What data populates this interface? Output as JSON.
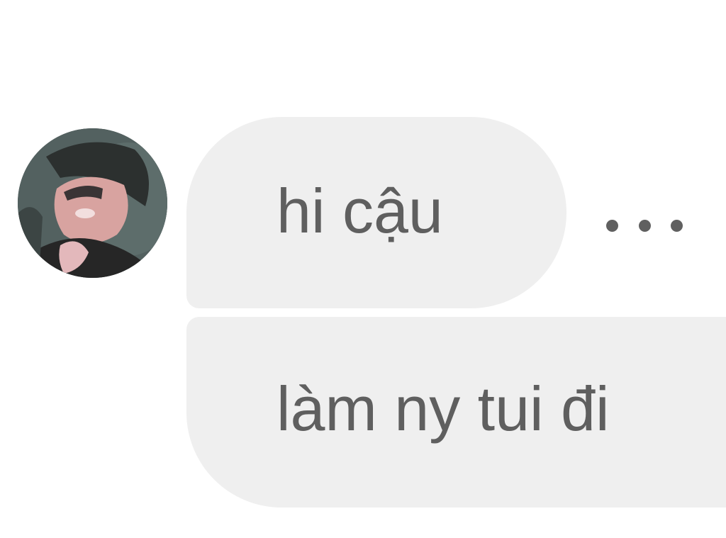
{
  "conversation": {
    "messages": [
      {
        "text": "hi cậu"
      },
      {
        "text": "làm ny tui đi"
      }
    ],
    "more_icon": "more-horizontal-icon",
    "bubble_color": "#efefef",
    "text_color": "#5f5f5f"
  }
}
